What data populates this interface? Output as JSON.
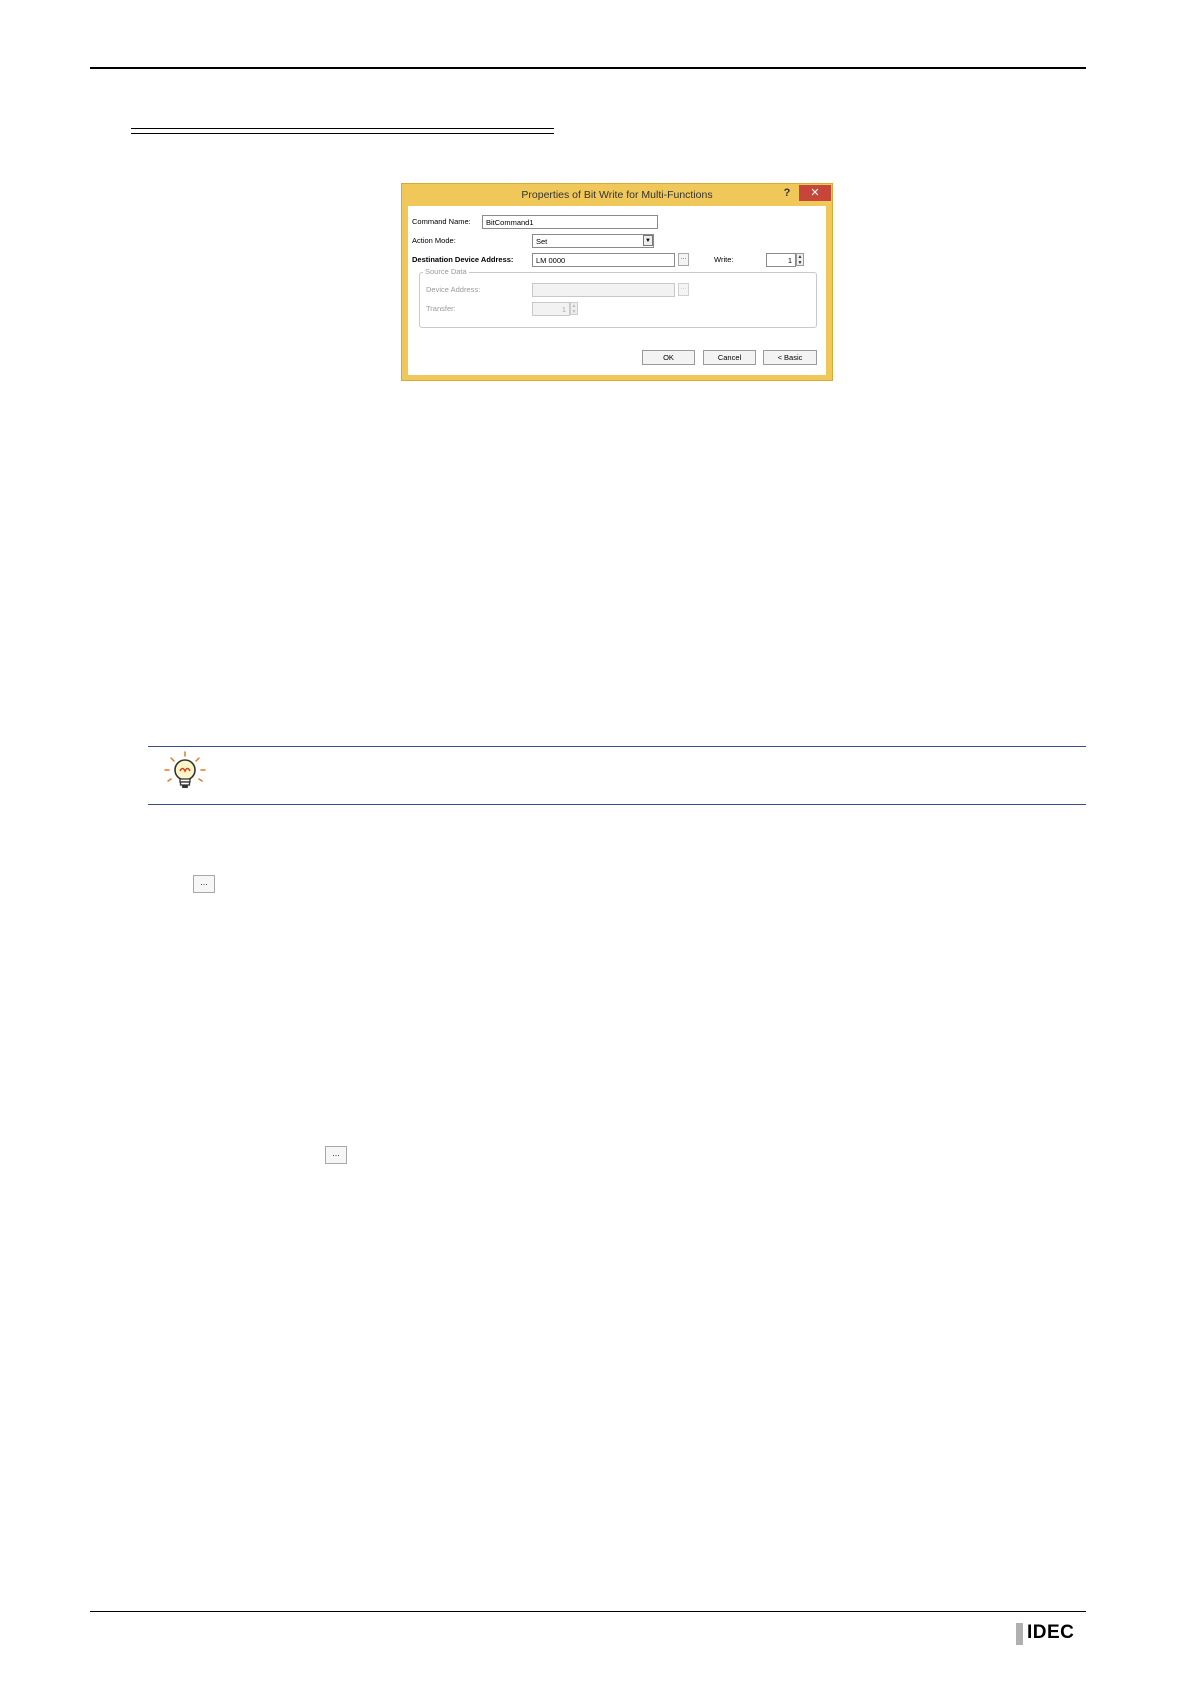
{
  "dialog": {
    "title": "Properties of Bit Write for Multi-Functions",
    "help_glyph": "?",
    "close_glyph": "✕",
    "command_name_label": "Command Name:",
    "command_name_value": "BitCommand1",
    "action_mode_label": "Action Mode:",
    "action_mode_value": "Set",
    "destination_label": "Destination Device Address:",
    "destination_value": "LM 0000",
    "ellipsis": "...",
    "write_label": "Write:",
    "write_value": "1",
    "source_data_legend": "Source Data",
    "device_address_label": "Device Address:",
    "device_address_value": "",
    "transfer_label": "Transfer:",
    "transfer_value": "1",
    "ok_label": "OK",
    "cancel_label": "Cancel",
    "basic_label": "< Basic"
  },
  "body": {
    "ellipsis_button_1": "...",
    "ellipsis_button_2": "..."
  },
  "footer": {
    "logo_text": "IDEC"
  }
}
